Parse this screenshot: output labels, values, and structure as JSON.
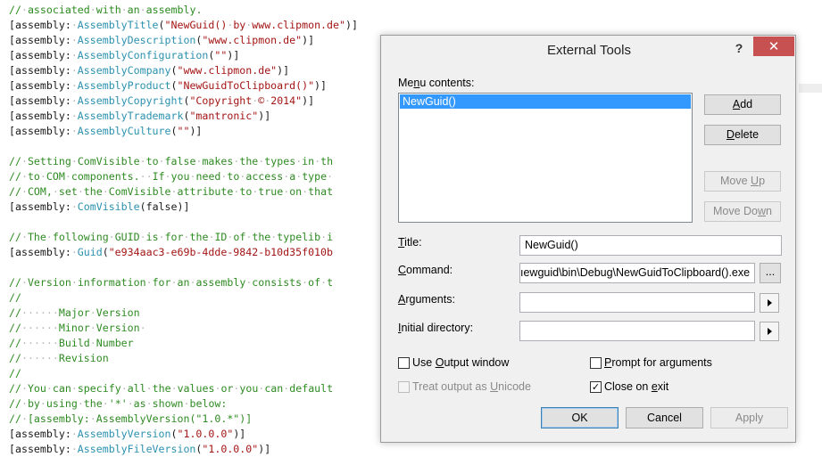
{
  "editor": {
    "lines": [
      {
        "t": "//·associated·with·an·assembly.",
        "k": "com"
      },
      {
        "t": "[assembly:·AssemblyTitle(\"NewGuid()·by·www.clipmon.de\")]",
        "k": "attr"
      },
      {
        "t": "[assembly:·AssemblyDescription(\"www.clipmon.de\")]",
        "k": "attr"
      },
      {
        "t": "[assembly:·AssemblyConfiguration(\"\")]",
        "k": "attr"
      },
      {
        "t": "[assembly:·AssemblyCompany(\"www.clipmon.de\")]",
        "k": "attr"
      },
      {
        "t": "[assembly:·AssemblyProduct(\"NewGuidToClipboard()\")]",
        "k": "attr"
      },
      {
        "t": "[assembly:·AssemblyCopyright(\"Copyright·©·2014\")]",
        "k": "attr"
      },
      {
        "t": "[assembly:·AssemblyTrademark(\"mantronic\")]",
        "k": "attr"
      },
      {
        "t": "[assembly:·AssemblyCulture(\"\")]",
        "k": "attr"
      },
      {
        "t": "",
        "k": "blank"
      },
      {
        "t": "//·Setting·ComVisible·to·false·makes·the·types·in·th",
        "k": "com"
      },
      {
        "t": "//·to·COM·components.··If·you·need·to·access·a·type·",
        "k": "com"
      },
      {
        "t": "//·COM,·set·the·ComVisible·attribute·to·true·on·that",
        "k": "com"
      },
      {
        "t": "[assembly:·ComVisible(false)]",
        "k": "attr"
      },
      {
        "t": "",
        "k": "blank"
      },
      {
        "t": "//·The·following·GUID·is·for·the·ID·of·the·typelib·i",
        "k": "com"
      },
      {
        "t": "[assembly:·Guid(\"e934aac3-e69b-4dde-9842-b10d35f010b",
        "k": "attr"
      },
      {
        "t": "",
        "k": "blank"
      },
      {
        "t": "//·Version·information·for·an·assembly·consists·of·t",
        "k": "com"
      },
      {
        "t": "//",
        "k": "com"
      },
      {
        "t": "//······Major·Version",
        "k": "com"
      },
      {
        "t": "//······Minor·Version·",
        "k": "com"
      },
      {
        "t": "//······Build·Number",
        "k": "com"
      },
      {
        "t": "//······Revision",
        "k": "com"
      },
      {
        "t": "//",
        "k": "com"
      },
      {
        "t": "//·You·can·specify·all·the·values·or·you·can·default",
        "k": "com"
      },
      {
        "t": "//·by·using·the·'*'·as·shown·below:",
        "k": "com"
      },
      {
        "t": "//·[assembly:·AssemblyVersion(\"1.0.*\")]",
        "k": "com"
      },
      {
        "t": "[assembly:·AssemblyVersion(\"1.0.0.0\")]",
        "k": "attr"
      },
      {
        "t": "[assembly:·AssemblyFileVersion(\"1.0.0.0\")]",
        "k": "attr"
      }
    ]
  },
  "dialog": {
    "title": "External Tools",
    "help_label": "?",
    "close_label": "✕",
    "menu_contents_label_pre": "Me",
    "menu_contents_label_u": "n",
    "menu_contents_label_post": "u contents:",
    "menu_items": [
      "NewGuid()"
    ],
    "buttons": {
      "add_u": "A",
      "add_rest": "dd",
      "delete_u": "D",
      "delete_rest": "elete",
      "move_up_pre": "Move ",
      "move_up_u": "U",
      "move_up_post": "p",
      "move_down_pre": "Move Do",
      "move_down_u": "w",
      "move_down_post": "n",
      "ok": "OK",
      "cancel": "Cancel",
      "apply": "Apply",
      "browse": "..."
    },
    "fields": {
      "title_label_u": "T",
      "title_label_rest": "itle:",
      "title_value": "NewGuid()",
      "command_label_u": "C",
      "command_label_rest": "ommand:",
      "command_value": "ıewguid\\bin\\Debug\\NewGuidToClipboard().exe",
      "arguments_label_u": "A",
      "arguments_label_rest": "rguments:",
      "arguments_value": "",
      "initial_dir_label_u": "I",
      "initial_dir_label_rest": "nitial directory:",
      "initial_dir_value": ""
    },
    "options": {
      "use_output_pre": "Use ",
      "use_output_u": "O",
      "use_output_post": "utput window",
      "use_output_checked": false,
      "prompt_args_u": "P",
      "prompt_args_rest": "rompt for arguments",
      "prompt_args_checked": false,
      "treat_unicode_pre": "Treat output as ",
      "treat_unicode_u": "U",
      "treat_unicode_post": "nicode",
      "treat_unicode_checked": false,
      "close_on_exit_pre": "Close on ",
      "close_on_exit_u": "e",
      "close_on_exit_post": "xit",
      "close_on_exit_checked": true
    }
  }
}
